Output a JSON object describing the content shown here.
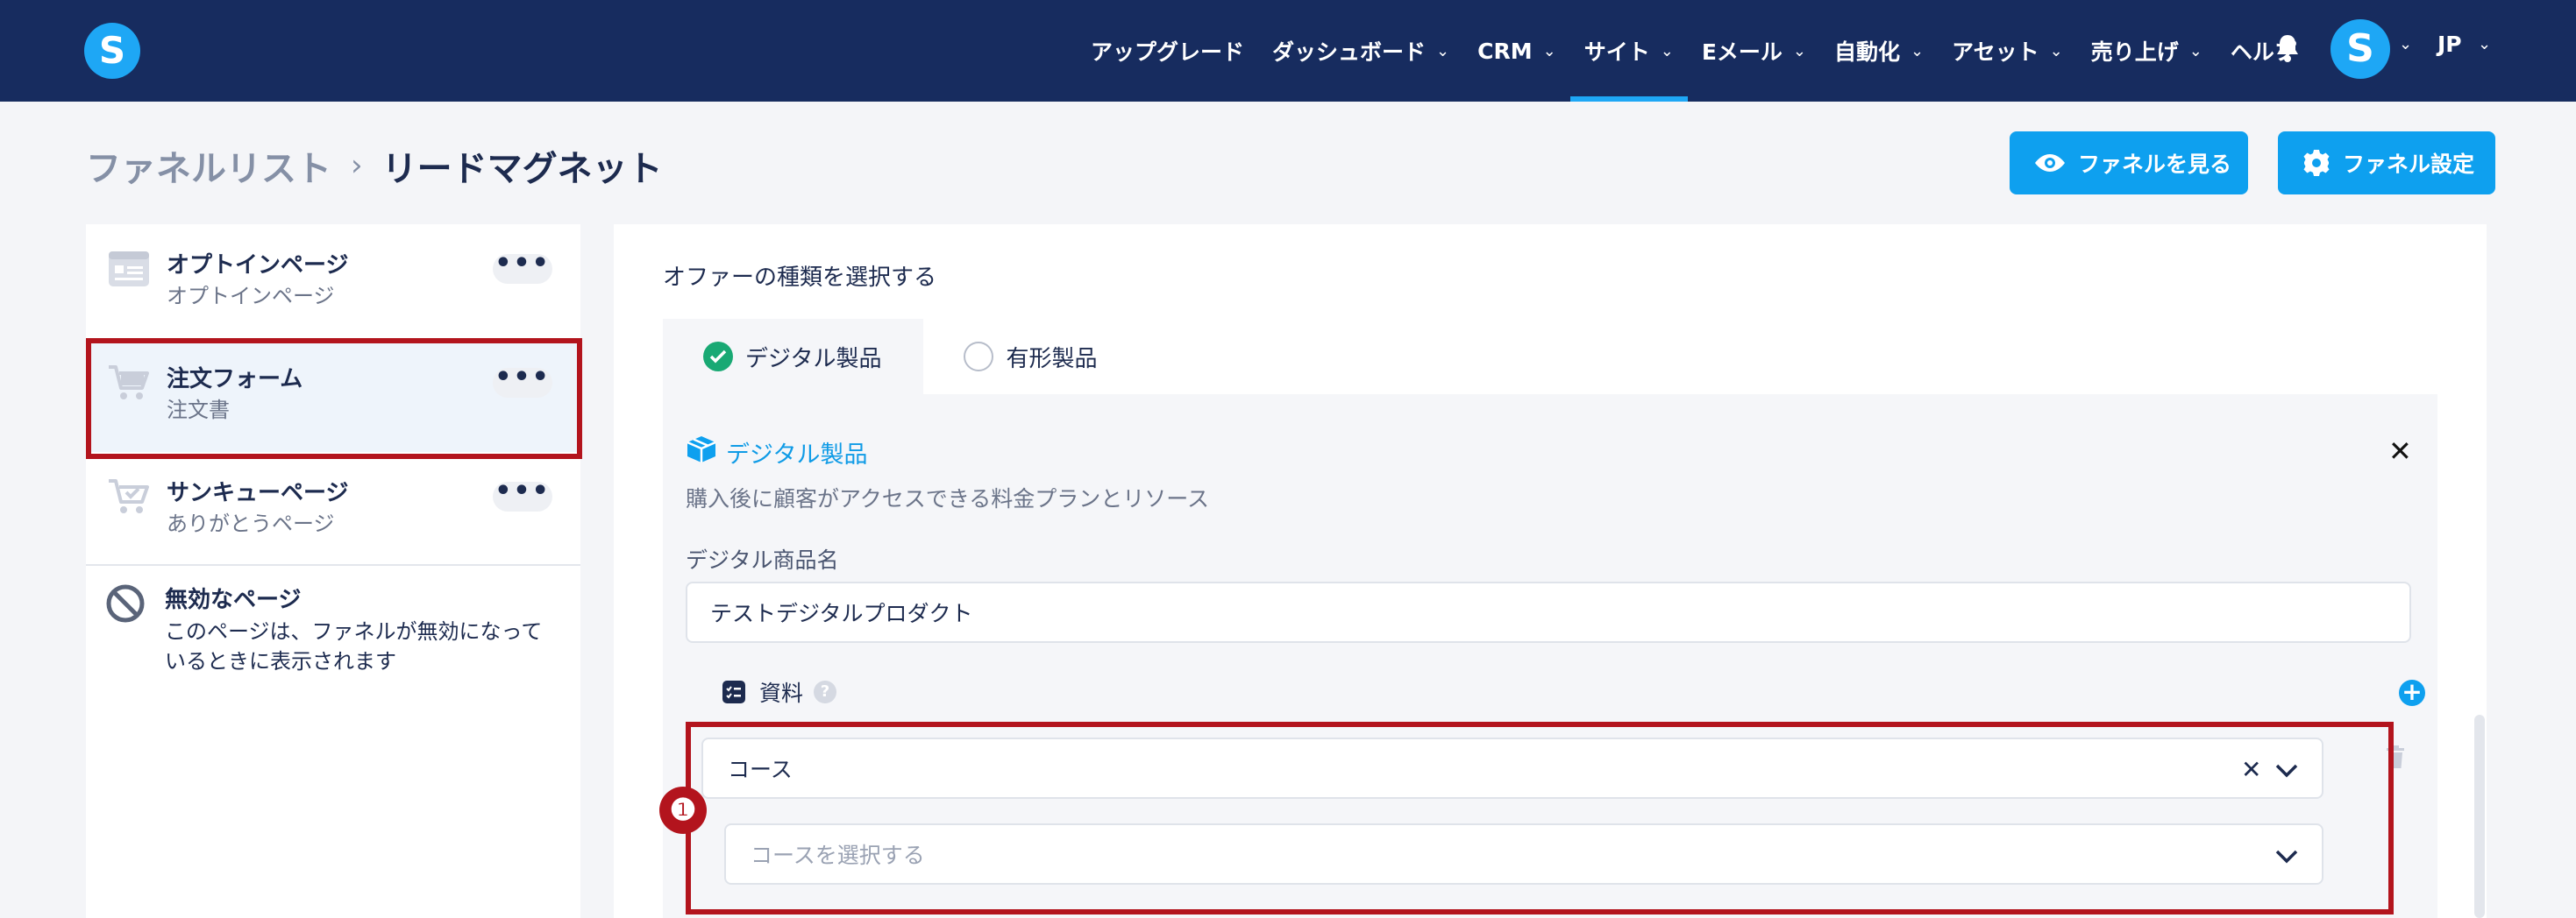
{
  "app": {
    "logo_letter": "S",
    "avatar_letter": "S",
    "language": "JP",
    "brand_color": "#1ea7f5",
    "header_color": "#172c5f"
  },
  "nav": {
    "items": [
      {
        "label": "アップグレード",
        "dropdown": false,
        "active": false
      },
      {
        "label": "ダッシュボード",
        "dropdown": true,
        "active": false
      },
      {
        "label": "CRM",
        "dropdown": true,
        "active": false
      },
      {
        "label": "サイト",
        "dropdown": true,
        "active": true
      },
      {
        "label": "Eメール",
        "dropdown": true,
        "active": false
      },
      {
        "label": "自動化",
        "dropdown": true,
        "active": false
      },
      {
        "label": "アセット",
        "dropdown": true,
        "active": false
      },
      {
        "label": "売り上げ",
        "dropdown": true,
        "active": false
      },
      {
        "label": "ヘルプ",
        "dropdown": false,
        "active": false
      }
    ],
    "icons": {
      "notifications": "bell-icon",
      "chevron": "chevron-down-icon"
    }
  },
  "breadcrumb": {
    "root": "ファネルリスト",
    "separator": "›",
    "current": "リードマグネット"
  },
  "header_buttons": {
    "view_funnel": {
      "label": "ファネルを見る",
      "icon": "eye-icon"
    },
    "funnel_settings": {
      "label": "ファネル設定",
      "icon": "gear-icon"
    }
  },
  "sidebar": {
    "steps": [
      {
        "title": "オプトインページ",
        "subtitle": "オプトインページ",
        "icon": "optin-page-icon",
        "selected": false
      },
      {
        "title": "注文フォーム",
        "subtitle": "注文書",
        "icon": "cart-icon",
        "selected": true
      },
      {
        "title": "サンキューページ",
        "subtitle": "ありがとうページ",
        "icon": "cart-check-icon",
        "selected": false
      }
    ],
    "more_glyph": "•••",
    "disabled_page": {
      "title": "無効なページ",
      "description": "このページは、ファネルが無効になっているときに表示されます",
      "icon": "prohibited-icon"
    }
  },
  "main": {
    "offer_type_label": "オファーの種類を選択する",
    "tabs": [
      {
        "label": "デジタル製品",
        "selected": true
      },
      {
        "label": "有形製品",
        "selected": false
      }
    ],
    "card": {
      "title": "デジタル製品",
      "description": "購入後に顧客がアクセスできる料金プランとリソース",
      "product_name_label": "デジタル商品名",
      "product_name_value": "テストデジタルプロダクト",
      "resources_label": "資料",
      "help_glyph": "?",
      "add_glyph": "+",
      "close_glyph": "✕",
      "resource_type_value": "コース",
      "clear_glyph": "✕",
      "course_select_placeholder": "コースを選択する"
    }
  },
  "annotation": {
    "badge_label": "❶",
    "highlight_color": "#b3141d"
  }
}
